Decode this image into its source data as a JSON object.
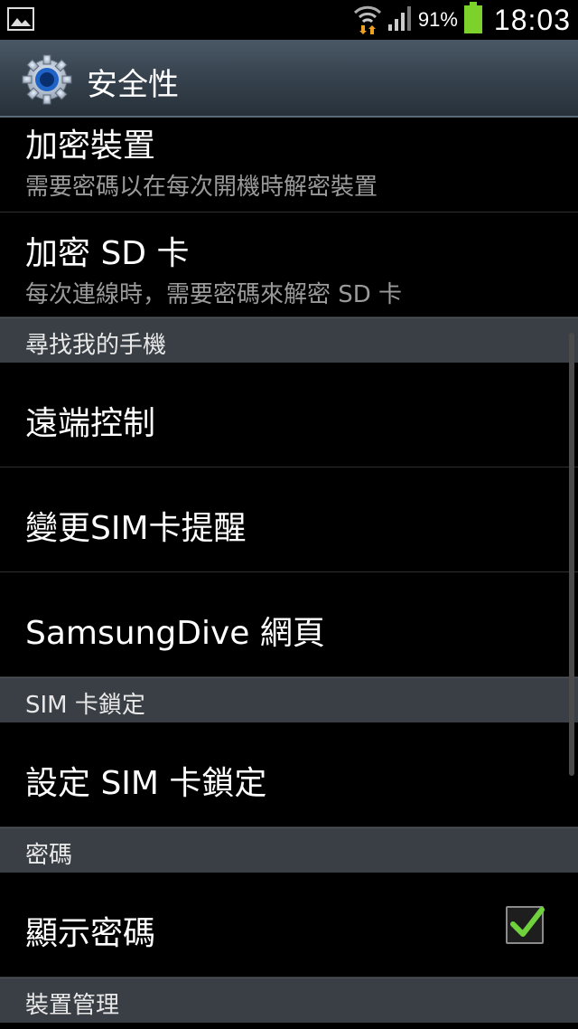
{
  "status_bar": {
    "battery_percent": "91%",
    "time": "18:03",
    "icons": [
      "image-notification-icon",
      "wifi-icon",
      "signal-icon",
      "battery-icon"
    ],
    "battery_color": "#7cd22a"
  },
  "header": {
    "title": "安全性",
    "icon": "gear-icon"
  },
  "rows": {
    "encrypt_device": {
      "title": "加密裝置",
      "summary": "需要密碼以在每次開機時解密裝置"
    },
    "encrypt_sd": {
      "title": "加密 SD 卡",
      "summary": "每次連線時，需要密碼來解密 SD 卡"
    },
    "remote_controls": {
      "title": "遠端控制"
    },
    "sim_change_alert": {
      "title": "變更SIM卡提醒"
    },
    "samsungdive": {
      "title": "SamsungDive 網頁"
    },
    "set_sim_lock": {
      "title": "設定 SIM 卡鎖定"
    },
    "show_password": {
      "title": "顯示密碼",
      "checked": true
    }
  },
  "sections": {
    "find_my_mobile": "尋找我的手機",
    "sim_lock": "SIM 卡鎖定",
    "passwords": "密碼",
    "device_admin": "裝置管理"
  },
  "colors": {
    "section_bg": "#3a3f45",
    "title_bar": "#34404b",
    "check_green": "#6fd23c"
  }
}
